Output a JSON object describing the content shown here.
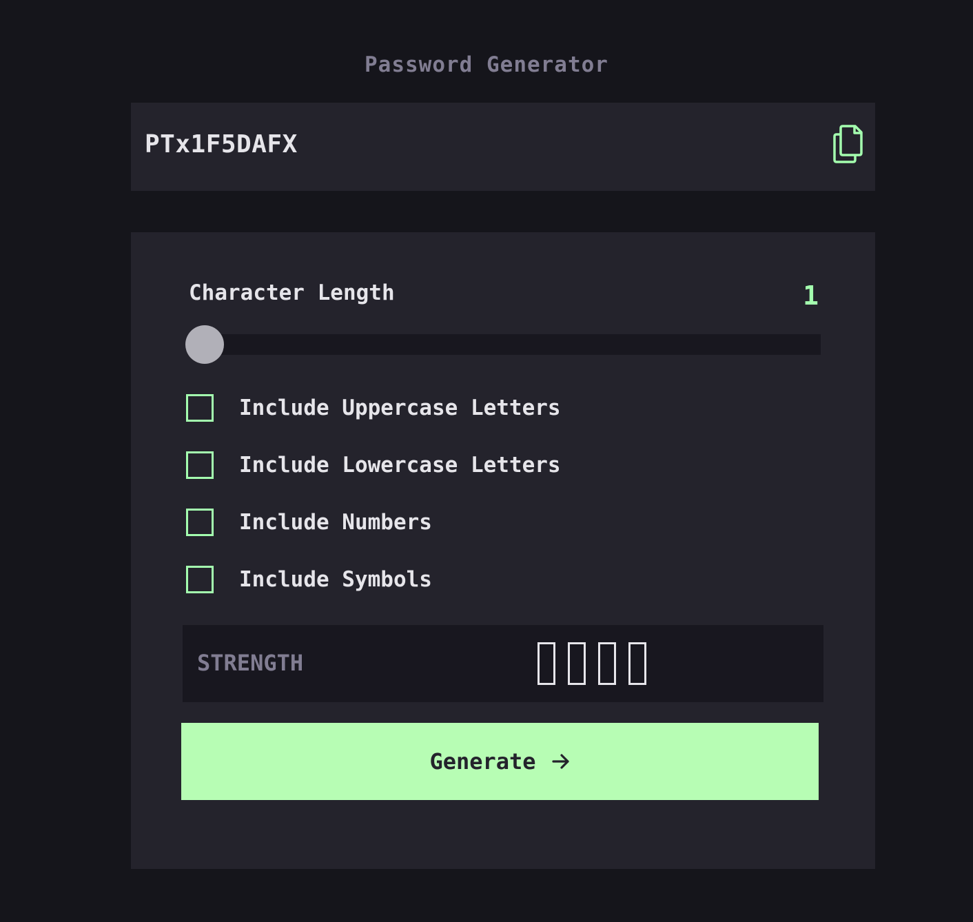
{
  "app": {
    "title": "Password Generator"
  },
  "password": {
    "value": "PTx1F5DAFX",
    "copy_icon": "copy-icon"
  },
  "length": {
    "label": "Character Length",
    "value": "1",
    "min": 1,
    "max": 20
  },
  "options": [
    {
      "label": "Include Uppercase Letters",
      "checked": false
    },
    {
      "label": "Include Lowercase Letters",
      "checked": false
    },
    {
      "label": "Include Numbers",
      "checked": false
    },
    {
      "label": "Include Symbols",
      "checked": false
    }
  ],
  "strength": {
    "label": "STRENGTH",
    "level": 0,
    "bars": 4
  },
  "generate": {
    "label": "Generate",
    "icon": "arrow-right-icon"
  },
  "colors": {
    "accent": "#a4ffaf",
    "background": "#15151b",
    "panel": "#24232c",
    "muted": "#817d92"
  }
}
